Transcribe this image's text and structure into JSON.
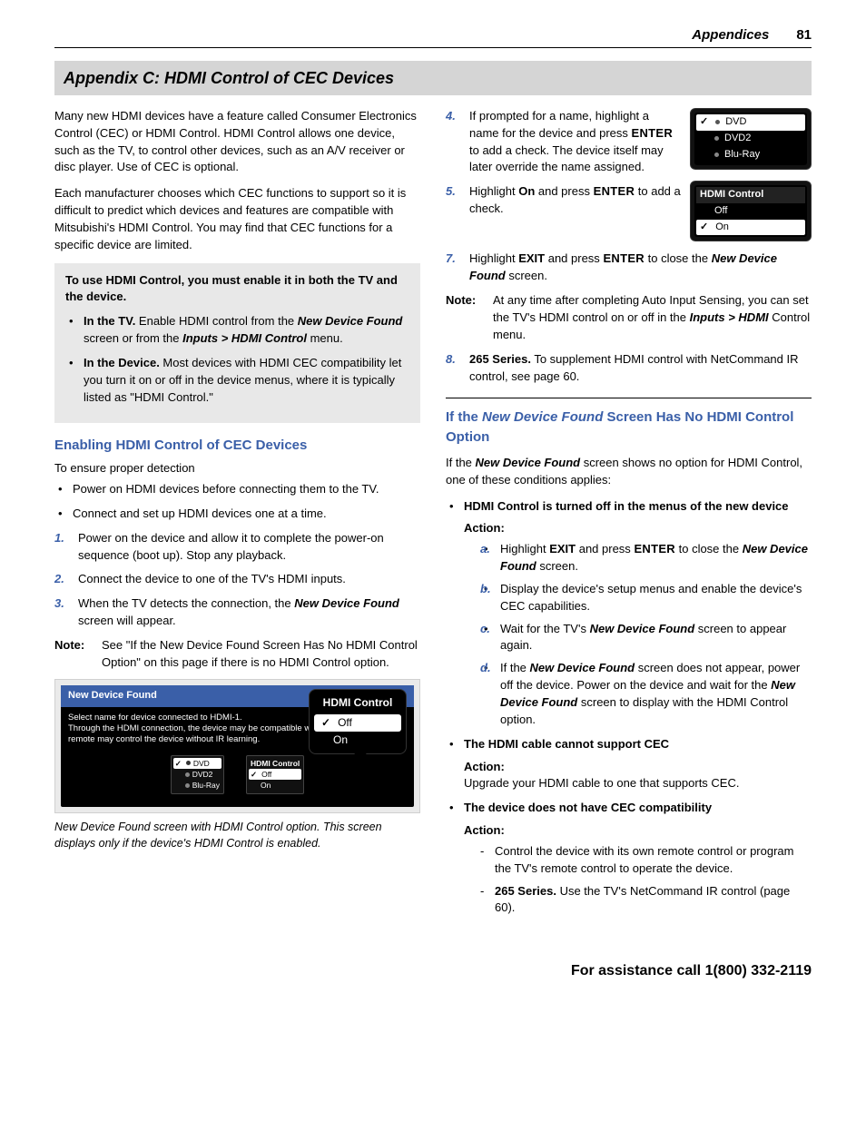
{
  "header": {
    "section": "Appendices",
    "page": "81"
  },
  "title": "Appendix C:  HDMI Control of CEC Devices",
  "left": {
    "p1": "Many new HDMI devices have a feature called Consumer Electronics Control (CEC) or HDMI Control. HDMI Control allows one device, such as the TV, to control other devices, such as an A/V receiver or disc player.  Use of CEC is optional.",
    "p2": "Each manufacturer chooses which CEC functions to support so it is difficult to predict which devices and features are compatible with Mitsubishi's HDMI Control.  You may find that CEC functions for a specific device are limited.",
    "graybox_intro": "To use HDMI Control, you must enable it in both the TV and the device.",
    "graybox_b1_bold": "In the TV.",
    "graybox_b1_rest1": "  Enable HDMI control from the ",
    "graybox_b1_em1": "New Device Found",
    "graybox_b1_rest2": " screen or from the ",
    "graybox_b1_em2": "Inputs > HDMI Control",
    "graybox_b1_rest3": " menu.",
    "graybox_b2_bold": "In the Device.",
    "graybox_b2_rest": "  Most devices with HDMI CEC compatibility let you turn it on or off in the device menus, where it is typically listed as \"HDMI Control.\"",
    "h_enable": "Enabling HDMI Control of CEC Devices",
    "ensure": "To ensure proper detection",
    "pre_b1": "Power on HDMI devices before connecting them to the TV.",
    "pre_b2": "Connect and set up HDMI devices one at a time.",
    "s1": "Power on the device and allow it to complete the power-on sequence (boot up).  Stop any playback.",
    "s2": "Connect the device to one of the TV's HDMI inputs.",
    "s3a": "When the TV detects the connection, the ",
    "s3_em": "New Device Found",
    "s3b": " screen will appear.",
    "noteL": "Note:",
    "note_body": "See \"If the New Device Found Screen Has No HDMI Control Option\" on this page if there is no HDMI Control option.",
    "ndf_title": "New Device Found",
    "ndf_line1": "Select name for device connected to HDMI-1.",
    "ndf_line2": "Through the HDMI connection, the device may be compatible with NetCommand.",
    "ndf_line3": "remote may control the device without IR learning.",
    "ndf_dev1": "DVD",
    "ndf_dev2": "DVD2",
    "ndf_dev3": "Blu-Ray",
    "ndf_hc": "HDMI Control",
    "ndf_off": "Off",
    "ndf_on": "On",
    "popup_title": "HDMI Control",
    "popup_off": "Off",
    "popup_on": "On",
    "caption": "New Device Found screen with HDMI Control option.  This screen displays only if the device's HDMI Control is enabled."
  },
  "right": {
    "s4a": "If prompted for a name, highlight a name for the device and press ",
    "s4_enter": "ENTER",
    "s4b": " to add a check.  The device itself may later override the name assigned.",
    "s5a": "Highlight ",
    "s5_on": "On",
    "s5b": " and press ",
    "s5_enter": "ENTER",
    "s5c": " to add a check.",
    "dev1": "DVD",
    "dev2": "DVD2",
    "dev3": "Blu-Ray",
    "hc_title": "HDMI Control",
    "hc_off": "Off",
    "hc_on": "On",
    "s7a": "Highlight ",
    "s7_exit": "EXIT",
    "s7b": " and press ",
    "s7_enter": "ENTER",
    "s7c": " to close the ",
    "s7_em": "New Device Found",
    "s7d": " screen.",
    "noteL": "Note:",
    "note_a": "At any time after completing Auto Input Sensing, you can set the TV's HDMI control on or off in the ",
    "note_em": "Inputs > HDMI",
    "note_b": " Control menu.",
    "s8_bold": "265 Series.",
    "s8_rest": "  To supplement HDMI control with NetCommand IR control, see page 60.",
    "opt_h_a": "If the ",
    "opt_h_em": "New Device Found",
    "opt_h_b": " Screen Has No HDMI Control Option",
    "opt_intro_a": "If the ",
    "opt_intro_em": "New Device Found",
    "opt_intro_b": " screen shows no option for HDMI Control, one of these conditions applies:",
    "c1_bold": "HDMI Control is turned off in the menus of the new device",
    "action": "Action:",
    "c1a_a": "Highlight ",
    "c1a_exit": "EXIT",
    "c1a_b": " and press ",
    "c1a_enter": "ENTER",
    "c1a_c": " to close the ",
    "c1a_em": "New Device Found",
    "c1a_d": " screen.",
    "c1b": "Display the device's setup menus and enable the device's CEC capabilities.",
    "c1c_a": "Wait for the TV's ",
    "c1c_em": "New Device Found",
    "c1c_b": " screen to appear again.",
    "c1d_a": "If the ",
    "c1d_em1": "New Device Found",
    "c1d_b": " screen does not appear, power off the device.  Power on the device and wait for the ",
    "c1d_em2": "New Device Found",
    "c1d_c": " screen to display with the HDMI Control option.",
    "c2_bold": "The HDMI cable cannot support CEC",
    "c2_body": "Upgrade your HDMI cable to one that supports CEC.",
    "c3_bold": "The device does not have CEC compatibility",
    "c3_d1": "Control the device with its own remote control or program the TV's remote control to operate the device.",
    "c3_d2_bold": "265 Series.",
    "c3_d2_rest": "  Use the TV's NetCommand IR control (page 60)."
  },
  "footer": "For assistance call 1(800) 332-2119"
}
